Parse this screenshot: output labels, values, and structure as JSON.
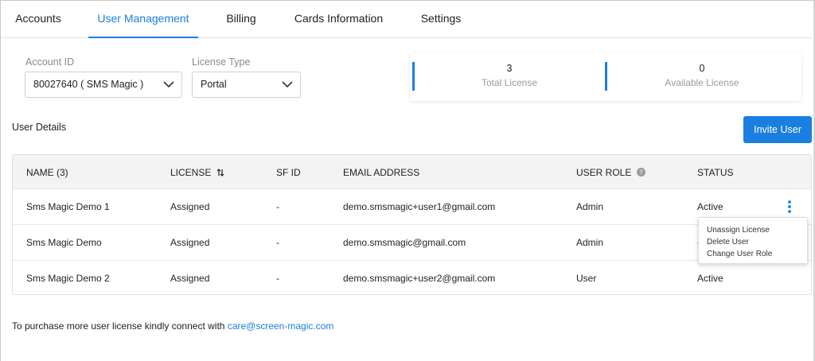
{
  "tabs": [
    {
      "label": "Accounts"
    },
    {
      "label": "User Management"
    },
    {
      "label": "Billing"
    },
    {
      "label": "Cards Information"
    },
    {
      "label": "Settings"
    }
  ],
  "active_tab": "User Management",
  "filters": {
    "account_id": {
      "label": "Account ID",
      "value": "80027640 ( SMS Magic )"
    },
    "license_type": {
      "label": "License Type",
      "value": "Portal"
    }
  },
  "license_summary": {
    "total": {
      "value": "3",
      "label": "Total License"
    },
    "available": {
      "value": "0",
      "label": "Available License"
    }
  },
  "section_title": "User Details",
  "invite_button": "Invite User",
  "table": {
    "headers": {
      "name": "NAME (3)",
      "license": "LICENSE",
      "sf_id": "SF ID",
      "email": "EMAIL ADDRESS",
      "role": "USER ROLE",
      "status": "STATUS"
    },
    "rows": [
      {
        "name": "Sms Magic Demo 1",
        "license": "Assigned",
        "sf_id": "-",
        "email": "demo.smsmagic+user1@gmail.com",
        "role": "Admin",
        "status": "Active"
      },
      {
        "name": "Sms Magic Demo",
        "license": "Assigned",
        "sf_id": "-",
        "email": "demo.smsmagic@gmail.com",
        "role": "Admin",
        "status": "-"
      },
      {
        "name": "Sms Magic Demo 2",
        "license": "Assigned",
        "sf_id": "-",
        "email": "demo.smsmagic+user2@gmail.com",
        "role": "User",
        "status": "Active"
      }
    ]
  },
  "row_menu": {
    "items": [
      "Unassign License",
      "Delete User",
      "Change User Role"
    ]
  },
  "footer": {
    "text": "To purchase more user license kindly connect with",
    "link": "care@screen-magic.com"
  },
  "colors": {
    "accent": "#1a7fe0",
    "header_bg": "#f3f3f3"
  }
}
